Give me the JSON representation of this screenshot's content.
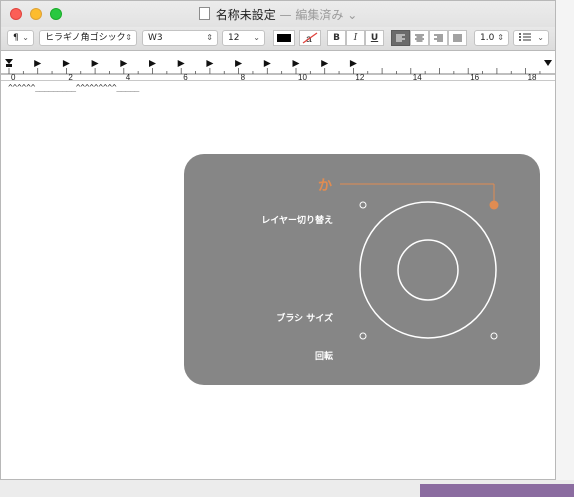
{
  "window": {
    "title": "名称未設定",
    "separator": "—",
    "status": "編集済み",
    "status_arrow": "⌄"
  },
  "toolbar": {
    "paragraph_style": "¶",
    "font_family": "ヒラギノ角ゴシック",
    "font_weight": "W3",
    "font_size": "12",
    "bold": "B",
    "italic": "I",
    "underline": "U",
    "line_spacing": "1.0",
    "list_icon": "list-icon"
  },
  "ruler": {
    "numbers": [
      "0",
      "2",
      "4",
      "6",
      "8",
      "10",
      "12",
      "14",
      "16",
      "18"
    ]
  },
  "document": {
    "text": "^^^^^^_________^^^^^^^^^_____"
  },
  "overlay": {
    "key_char": "か",
    "labels": {
      "layer_switch": "レイヤー切り替え",
      "brush_size": "ブラシ サイズ",
      "rotate": "回転"
    },
    "colors": {
      "panel": "#868686",
      "accent": "#e08c52",
      "line": "#ffffff"
    }
  }
}
